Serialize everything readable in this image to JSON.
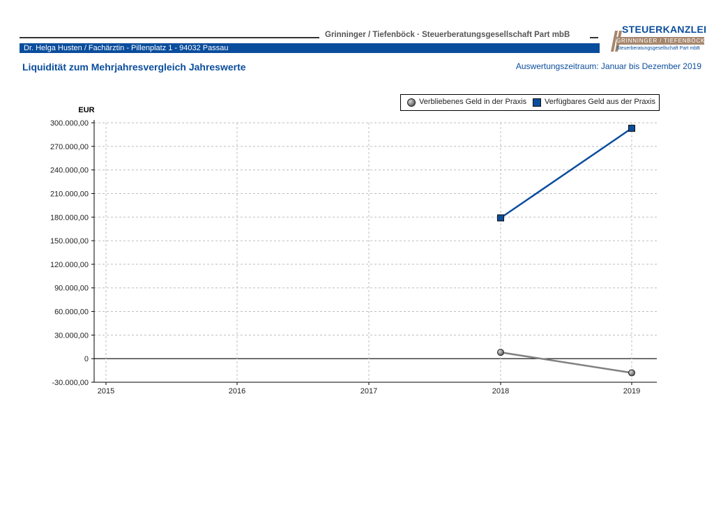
{
  "header": {
    "firm_name": "Grinninger / Tiefenböck · Steuerberatungsgesellschaft Part mbB",
    "client_line": "Dr. Helga Husten / Fachärztin  -  Pillenplatz 1  -  94032 Passau",
    "report_title": "Liquidität zum Mehrjahresvergleich Jahreswerte",
    "period": "Auswertungszeitraum: Januar bis Dezember 2019"
  },
  "logo": {
    "title": "STEUERKANZLEI",
    "names": "GRINNINGER / TIEFENBÖCK",
    "tagline": "Steuerberatungsgesellschaft Part mbB",
    "colors": {
      "blue": "#0a4d9c",
      "brown": "#a5866c"
    }
  },
  "chart_data": {
    "type": "line",
    "title": "",
    "xlabel": "",
    "ylabel": "EUR",
    "categories": [
      "2015",
      "2016",
      "2017",
      "2018",
      "2019"
    ],
    "ylim": [
      -30000,
      300000
    ],
    "yticks": [
      -30000,
      0,
      30000,
      60000,
      90000,
      120000,
      150000,
      180000,
      210000,
      240000,
      270000,
      300000
    ],
    "ytick_labels": [
      "-30.000,00",
      "0",
      "30.000,00",
      "60.000,00",
      "90.000,00",
      "120.000,00",
      "150.000,00",
      "180.000,00",
      "210.000,00",
      "240.000,00",
      "270.000,00",
      "300.000,00"
    ],
    "grid": true,
    "legend_position": "top-right",
    "series": [
      {
        "name": "Verbliebenes Geld in der Praxis",
        "marker": "circle",
        "color": "#808080",
        "values": [
          null,
          null,
          null,
          8000,
          -18000
        ]
      },
      {
        "name": "Verfügbares Geld aus der Praxis",
        "marker": "square",
        "color": "#0a4d9c",
        "values": [
          null,
          null,
          null,
          179000,
          293000
        ]
      }
    ]
  }
}
